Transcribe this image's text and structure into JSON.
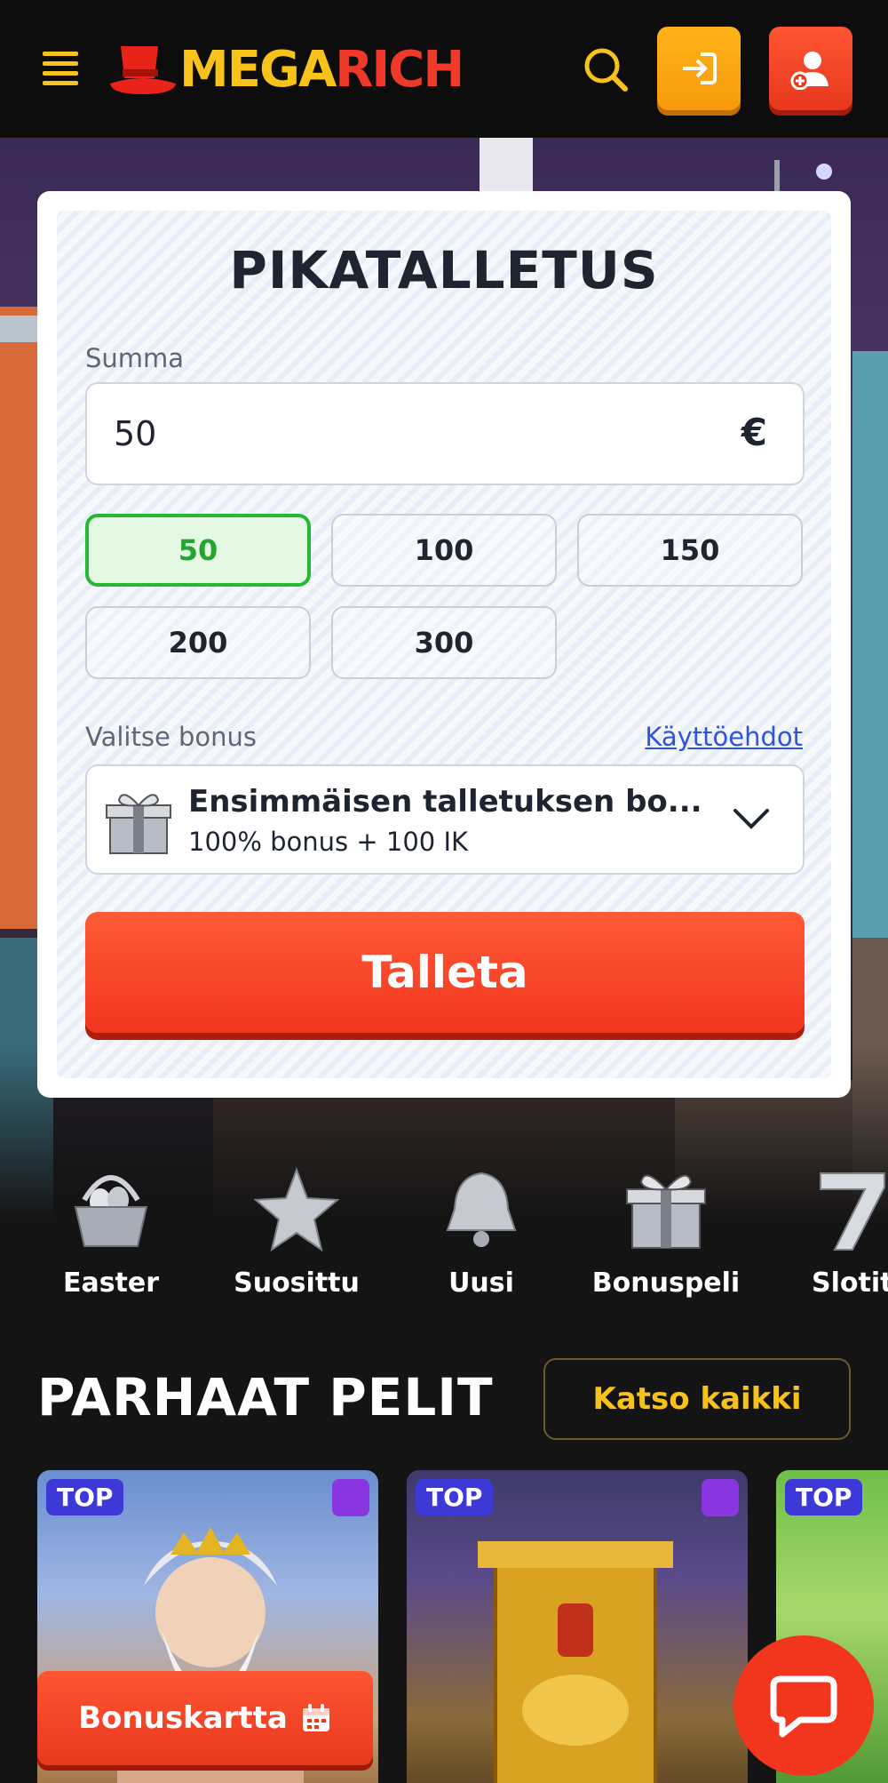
{
  "header": {
    "logo_mega": "MEGA",
    "logo_rich": "RICH",
    "icons": {
      "menu": "hamburger-icon",
      "search": "search-icon",
      "login": "login-icon",
      "register": "add-user-icon"
    }
  },
  "quick_deposit": {
    "title": "PIKATALLETUS",
    "amount_label": "Summa",
    "amount_value": "50",
    "currency": "€",
    "chips": [
      "50",
      "100",
      "150",
      "200",
      "300"
    ],
    "selected_chip": "50",
    "bonus_label": "Valitse bonus",
    "terms_link": "Käyttöehdot",
    "bonus": {
      "title": "Ensimmäisen talletuksen bo...",
      "subtitle": "100% bonus + 100 IK"
    },
    "deposit_button": "Talleta"
  },
  "categories": [
    "Easter",
    "Suosittu",
    "Uusi",
    "Bonuspeli",
    "Slotit"
  ],
  "top_games": {
    "title": "PARHAAT PELIT",
    "see_all": "Katso kaikki",
    "badge": "TOP"
  },
  "floating": {
    "bonus_map": "Bonuskartta"
  },
  "colors": {
    "accent_yellow": "#f7c21a",
    "accent_red": "#f1361d",
    "selected_green": "#25b832",
    "link_blue": "#2e55d8"
  }
}
